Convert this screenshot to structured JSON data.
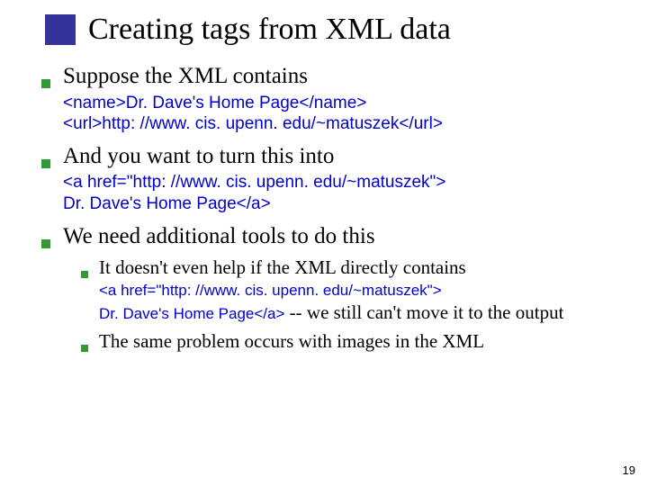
{
  "title": "Creating tags from XML data",
  "bullets": {
    "b1": {
      "text": "Suppose the XML contains",
      "code_l1": "<name>Dr. Dave's Home Page</name>",
      "code_l2": "<url>http: //www. cis. upenn. edu/~matuszek</url>"
    },
    "b2": {
      "text": "And you want to turn this into",
      "code_l1": "<a href=\"http: //www. cis. upenn. edu/~matuszek\">",
      "code_l2": "Dr. Dave's Home Page</a>"
    },
    "b3": {
      "text": "We need additional tools to do this",
      "sub": {
        "s1": {
          "text": "It doesn't even help if the XML directly contains",
          "code_l1": "<a href=\"http: //www. cis. upenn. edu/~matuszek\">",
          "code_l2_code": "Dr. Dave's Home Page</a>",
          "code_l2_tail": " -- we still can't move it to the output"
        },
        "s2": {
          "text": "The same problem occurs with images in the XML"
        }
      }
    }
  },
  "page_number": "19"
}
